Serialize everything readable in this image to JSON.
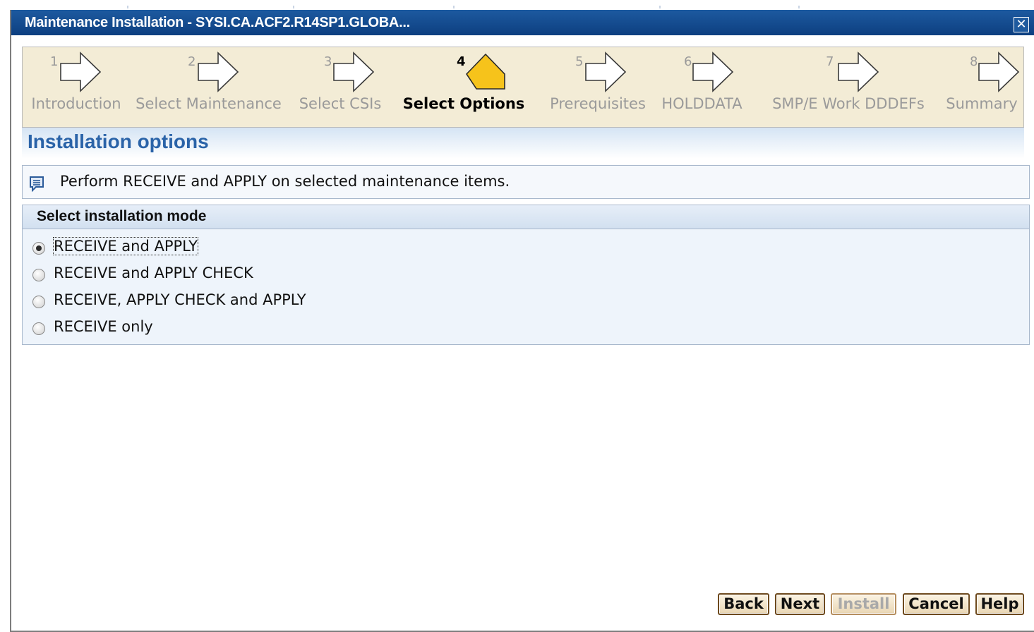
{
  "window": {
    "title": "Maintenance Installation - SYSI.CA.ACF2.R14SP1.GLOBA...",
    "close_glyph": "✕"
  },
  "wizard": {
    "steps": [
      {
        "number": "1",
        "label": "Introduction",
        "active": false
      },
      {
        "number": "2",
        "label": "Select Maintenance",
        "active": false
      },
      {
        "number": "3",
        "label": "Select CSIs",
        "active": false
      },
      {
        "number": "4",
        "label": "Select Options",
        "active": true
      },
      {
        "number": "5",
        "label": "Prerequisites",
        "active": false
      },
      {
        "number": "6",
        "label": "HOLDDATA",
        "active": false
      },
      {
        "number": "7",
        "label": "SMP/E Work DDDEFs",
        "active": false
      },
      {
        "number": "8",
        "label": "Summary",
        "active": false
      }
    ],
    "active_color": "#f6c31b",
    "inactive_color": "#ffffff"
  },
  "section": {
    "title": "Installation options"
  },
  "info": {
    "icon": "message-icon",
    "text": "Perform RECEIVE and APPLY on selected maintenance items."
  },
  "install_mode": {
    "header": "Select installation mode",
    "options": [
      {
        "label": "RECEIVE and APPLY",
        "checked": true
      },
      {
        "label": "RECEIVE and APPLY CHECK",
        "checked": false
      },
      {
        "label": "RECEIVE, APPLY CHECK and APPLY",
        "checked": false
      },
      {
        "label": "RECEIVE only",
        "checked": false
      }
    ]
  },
  "buttons": {
    "back": "Back",
    "next": "Next",
    "install": "Install",
    "cancel": "Cancel",
    "help": "Help"
  }
}
